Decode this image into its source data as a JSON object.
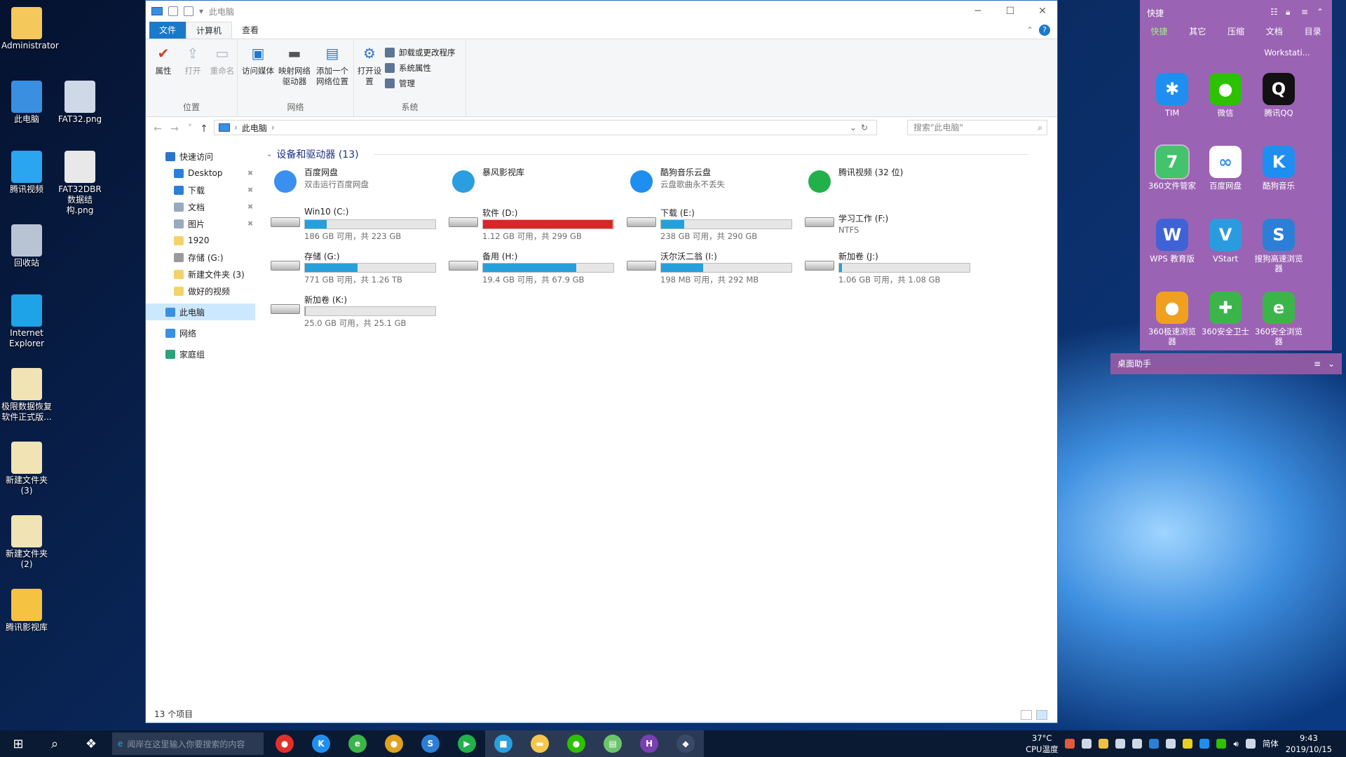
{
  "desktop_icons": [
    {
      "label": "Administrator",
      "color": "#f4c85a"
    },
    {
      "label": "此电脑",
      "color": "#3a8fe0"
    },
    {
      "label": "FAT32.png",
      "color": "#cfd8e6"
    },
    {
      "label": "腾讯视频",
      "color": "#2aa6f0"
    },
    {
      "label": "FAT32DBR数据结构.png",
      "color": "#e8e8e8"
    },
    {
      "label": "回收站",
      "color": "#b8c4d4"
    },
    {
      "label": "Internet Explorer",
      "color": "#1fa3e8"
    },
    {
      "label": "极限数据恢复软件正式版...",
      "color": "#f0e3b4"
    },
    {
      "label": "新建文件夹 (3)",
      "color": "#f0e3b4"
    },
    {
      "label": "新建文件夹 (2)",
      "color": "#f0e3b4"
    },
    {
      "label": "腾讯影视库",
      "color": "#f5c242"
    }
  ],
  "window": {
    "title": "此电脑",
    "tabs": [
      "文件",
      "计算机",
      "查看"
    ],
    "ribbon": {
      "location": {
        "label": "位置",
        "buttons": [
          "属性",
          "打开",
          "重命名"
        ]
      },
      "network": {
        "label": "网络",
        "buttons": [
          "访问媒体",
          "映射网络驱动器",
          "添加一个网络位置"
        ]
      },
      "system": {
        "label": "系统",
        "open_settings": "打开设置",
        "items": [
          "卸载或更改程序",
          "系统属性",
          "管理"
        ]
      }
    },
    "address": {
      "path": "此电脑",
      "search_placeholder": "搜索\"此电脑\""
    },
    "nav": [
      {
        "label": "快速访问",
        "pinned": false,
        "color": "#2b75c9"
      },
      {
        "label": "Desktop",
        "pinned": true,
        "color": "#2b7fd6"
      },
      {
        "label": "下载",
        "pinned": true,
        "color": "#2b7fd6"
      },
      {
        "label": "文档",
        "pinned": true,
        "color": "#9aa8bd"
      },
      {
        "label": "图片",
        "pinned": true,
        "color": "#9aa8bd"
      },
      {
        "label": "1920",
        "pinned": false,
        "color": "#f3d26a"
      },
      {
        "label": "存储 (G:)",
        "pinned": false,
        "color": "#9a9a9a"
      },
      {
        "label": "新建文件夹 (3)",
        "pinned": false,
        "color": "#f3d26a"
      },
      {
        "label": "做好的视频",
        "pinned": false,
        "color": "#f3d26a"
      },
      {
        "label": "此电脑",
        "pinned": false,
        "color": "#3a8fe0"
      },
      {
        "label": "网络",
        "pinned": false,
        "color": "#3a8fe0"
      },
      {
        "label": "家庭组",
        "pinned": false,
        "color": "#2aa37a"
      }
    ],
    "section_title": "设备和驱动器 (13)",
    "apps": [
      {
        "name": "百度网盘",
        "sub": "双击运行百度网盘",
        "color": "#3b8ff0"
      },
      {
        "name": "暴风影视库",
        "sub": "",
        "color": "#2a9ee0"
      },
      {
        "name": "酷狗音乐云盘",
        "sub": "云盘歌曲永不丢失",
        "color": "#1e8ff0"
      },
      {
        "name": "腾讯视频 (32 位)",
        "sub": "",
        "color": "#22b04a"
      }
    ],
    "drives": [
      {
        "name": "Win10 (C:)",
        "info": "186 GB 可用，共 223 GB",
        "used": 0.166,
        "critical": false,
        "bar": true
      },
      {
        "name": "软件 (D:)",
        "info": "1.12 GB 可用，共 299 GB",
        "used": 0.996,
        "critical": true,
        "bar": true
      },
      {
        "name": "下载 (E:)",
        "info": "238 GB 可用，共 290 GB",
        "used": 0.179,
        "critical": false,
        "bar": true
      },
      {
        "name": "学习工作 (F:)",
        "info": "NTFS",
        "used": 0,
        "critical": false,
        "bar": false
      },
      {
        "name": "存储 (G:)",
        "info": "771 GB 可用，共 1.26 TB",
        "used": 0.402,
        "critical": false,
        "bar": true
      },
      {
        "name": "备用 (H:)",
        "info": "19.4 GB 可用，共 67.9 GB",
        "used": 0.714,
        "critical": false,
        "bar": true
      },
      {
        "name": "沃尔沃二翁 (I:)",
        "info": "198 MB 可用，共 292 MB",
        "used": 0.322,
        "critical": false,
        "bar": true
      },
      {
        "name": "新加卷 (J:)",
        "info": "1.06 GB 可用，共 1.08 GB",
        "used": 0.019,
        "critical": false,
        "bar": true
      },
      {
        "name": "新加卷 (K:)",
        "info": "25.0 GB 可用，共 25.1 GB",
        "used": 0.004,
        "critical": false,
        "bar": true
      }
    ],
    "status": "13 个项目"
  },
  "panel": {
    "title": "快捷",
    "tabs": [
      "快捷",
      "其它",
      "压缩",
      "文档",
      "目录"
    ],
    "top_label": "Workstati...",
    "icons": [
      {
        "label": "TIM",
        "color": "#1e8ff0",
        "glyph": "✱"
      },
      {
        "label": "微信",
        "color": "#2dc100",
        "glyph": "●"
      },
      {
        "label": "腾讯QQ",
        "color": "#111111",
        "glyph": "Q"
      },
      {
        "label": "360文件管家",
        "color": "#43c36b",
        "glyph": "7"
      },
      {
        "label": "百度网盘",
        "color": "#ffffff",
        "glyph": "∞"
      },
      {
        "label": "酷狗音乐",
        "color": "#1e8ff0",
        "glyph": "K"
      },
      {
        "label": "WPS 教育版",
        "color": "#3f63d6",
        "glyph": "W"
      },
      {
        "label": "VStart",
        "color": "#2b9be0",
        "glyph": "V"
      },
      {
        "label": "搜狗高速浏览器",
        "color": "#2b7fd6",
        "glyph": "S"
      },
      {
        "label": "360极速浏览器",
        "color": "#f0a020",
        "glyph": "●"
      },
      {
        "label": "360安全卫士",
        "color": "#3bb54a",
        "glyph": "✚"
      },
      {
        "label": "360安全浏览器",
        "color": "#3bb54a",
        "glyph": "e"
      }
    ],
    "helper": "桌面助手"
  },
  "taskbar": {
    "search_placeholder": "闻岸在这里输入你要搜索的内容",
    "apps": [
      {
        "name": "360-icon",
        "color": "#e0302a",
        "glyph": "●"
      },
      {
        "name": "kugou-icon",
        "color": "#1e8ff0",
        "glyph": "K"
      },
      {
        "name": "360browser-icon",
        "color": "#3bb54a",
        "glyph": "e"
      },
      {
        "name": "chrome-icon",
        "color": "#e0a020",
        "glyph": "●"
      },
      {
        "name": "sogou-icon",
        "color": "#2b7fd6",
        "glyph": "S"
      },
      {
        "name": "tencent-video-icon",
        "color": "#22b04a",
        "glyph": "▶"
      },
      {
        "name": "baofeng-icon",
        "color": "#2a9ee0",
        "glyph": "■"
      },
      {
        "name": "explorer-icon",
        "color": "#f3c84a",
        "glyph": "▬"
      },
      {
        "name": "wechat-icon",
        "color": "#2dc100",
        "glyph": "●"
      },
      {
        "name": "notepad-icon",
        "color": "#6bc46b",
        "glyph": "▤"
      },
      {
        "name": "hex-icon",
        "color": "#7a3fb0",
        "glyph": "H"
      },
      {
        "name": "terminal-icon",
        "color": "#3a4a66",
        "glyph": "◆"
      }
    ],
    "temp": "37°C",
    "temp_label": "CPU温度",
    "ime": "简体",
    "time": "9:43",
    "date": "2019/10/15"
  }
}
